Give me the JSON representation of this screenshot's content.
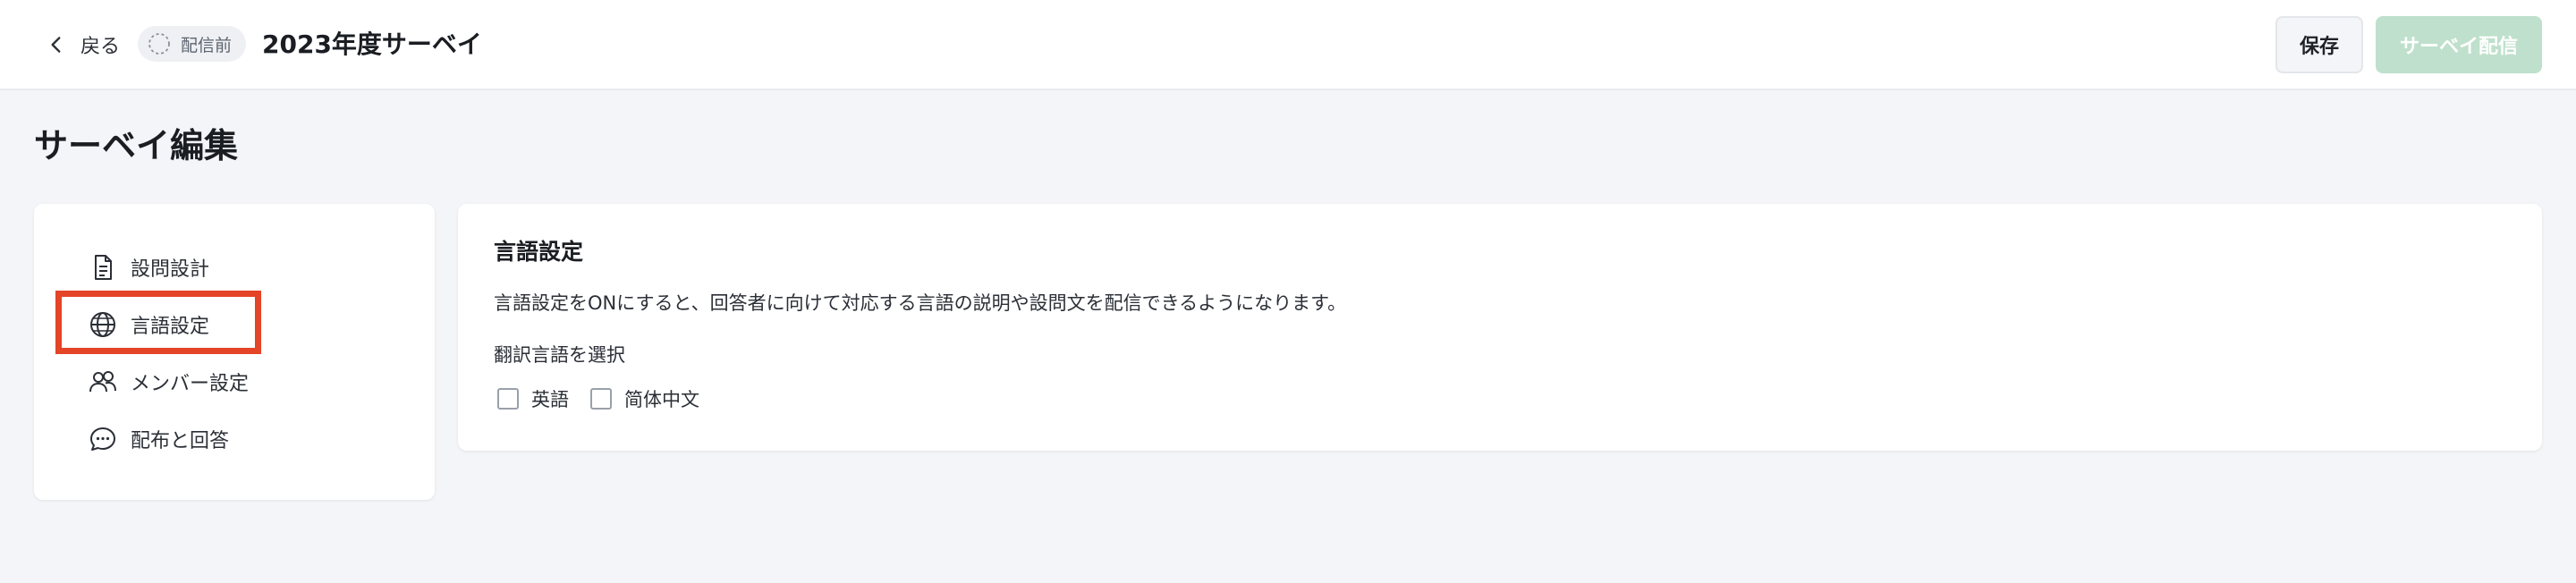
{
  "header": {
    "back_label": "戻る",
    "status_badge": "配信前",
    "survey_title": "2023年度サーベイ",
    "save_label": "保存",
    "publish_label": "サーベイ配信"
  },
  "page": {
    "title": "サーベイ編集"
  },
  "sidebar": {
    "items": [
      {
        "label": "設問設計",
        "icon": "document-icon"
      },
      {
        "label": "言語設定",
        "icon": "globe-icon"
      },
      {
        "label": "メンバー設定",
        "icon": "users-icon"
      },
      {
        "label": "配布と回答",
        "icon": "chat-bubble-icon"
      }
    ]
  },
  "main": {
    "section_title": "言語設定",
    "description": "言語設定をONにすると、回答者に向けて対応する言語の説明や設問文を配信できるようになります。",
    "select_label": "翻訳言語を選択",
    "languages": [
      {
        "label": "英語",
        "checked": false
      },
      {
        "label": "简体中文",
        "checked": false
      }
    ]
  },
  "colors": {
    "highlight": "#e44427",
    "publish_button_disabled": "#bfe0cc",
    "page_background": "#f4f5f8"
  }
}
